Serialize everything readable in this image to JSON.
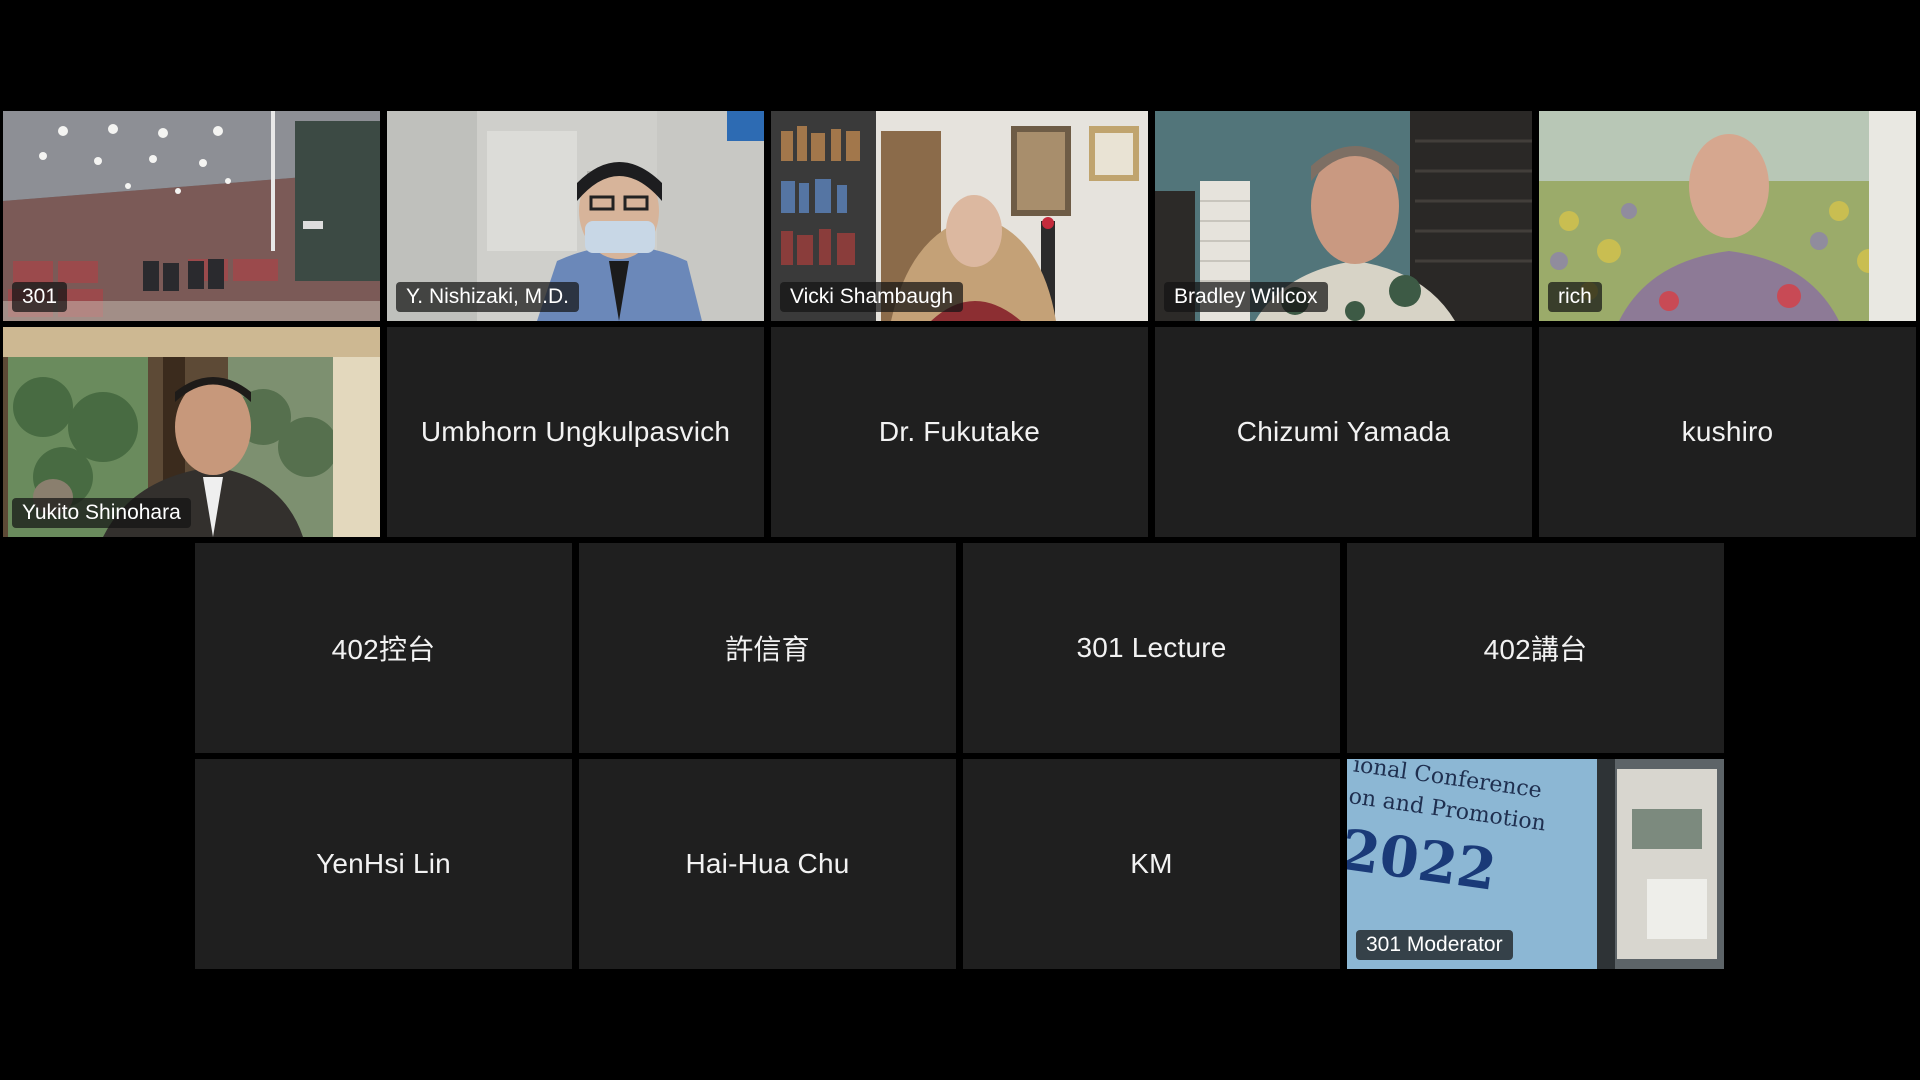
{
  "meeting": {
    "participants": [
      {
        "name": "301",
        "video": true
      },
      {
        "name": "Y. Nishizaki, M.D.",
        "video": true
      },
      {
        "name": "Vicki Shambaugh",
        "video": true
      },
      {
        "name": "Bradley Willcox",
        "video": true
      },
      {
        "name": "rich",
        "video": true
      },
      {
        "name": "Yukito Shinohara",
        "video": true
      },
      {
        "name": "Umbhorn Ungkulpasvich",
        "video": false
      },
      {
        "name": "Dr. Fukutake",
        "video": false
      },
      {
        "name": "Chizumi Yamada",
        "video": false
      },
      {
        "name": "kushiro",
        "video": false
      },
      {
        "name": "402控台",
        "video": false
      },
      {
        "name": "許信育",
        "video": false
      },
      {
        "name": "301 Lecture",
        "video": false
      },
      {
        "name": "402講台",
        "video": false
      },
      {
        "name": "YenHsi Lin",
        "video": false
      },
      {
        "name": "Hai-Hua Chu",
        "video": false
      },
      {
        "name": "KM",
        "video": false
      },
      {
        "name": "301 Moderator",
        "video": true
      }
    ],
    "shared_screen_text": {
      "line1": "ional Conference",
      "line2": "on and Promotion",
      "year": "2022"
    }
  }
}
